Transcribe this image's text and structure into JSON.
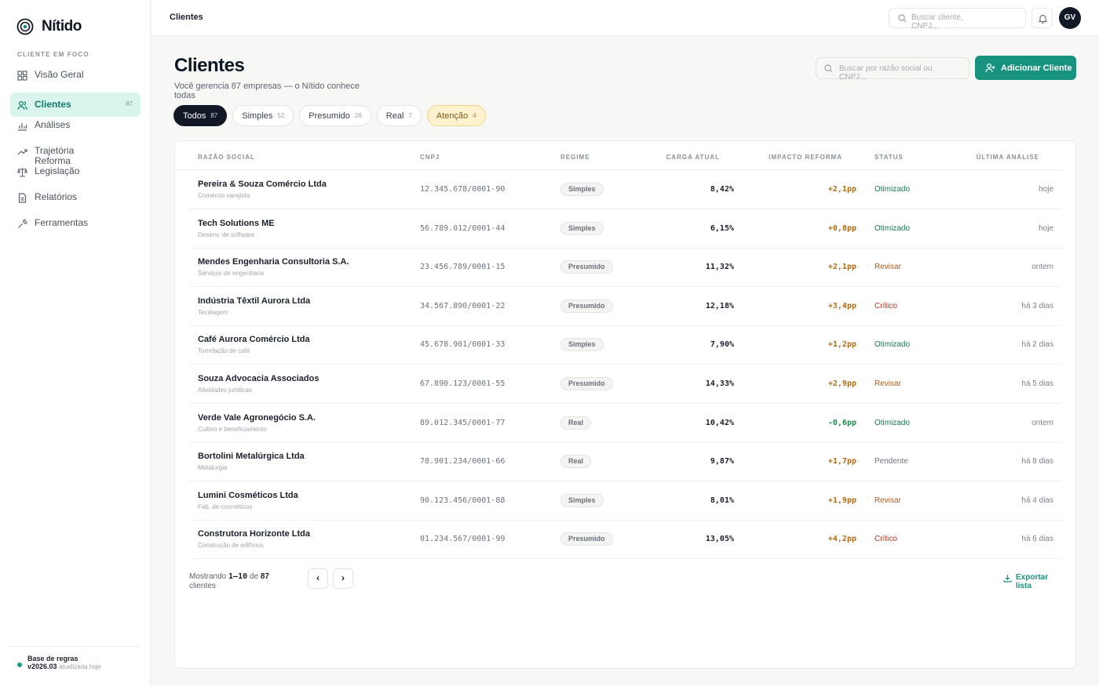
{
  "brand": {
    "name": "Nítido"
  },
  "sidebar": {
    "section_label": "CLIENTE EM FOCO",
    "items": [
      {
        "label": "Visão Geral",
        "icon": "grid-icon",
        "count": ""
      },
      {
        "label": "Clientes",
        "icon": "users-icon",
        "count": "87"
      },
      {
        "label": "Análises",
        "icon": "bar-chart-icon",
        "count": ""
      },
      {
        "label": "Trajetória Reforma",
        "icon": "trend-up-icon",
        "count": ""
      },
      {
        "label": "Legislação",
        "icon": "scale-icon",
        "count": ""
      },
      {
        "label": "Relatórios",
        "icon": "document-icon",
        "count": ""
      },
      {
        "label": "Ferramentas",
        "icon": "wrench-icon",
        "count": ""
      }
    ],
    "footer": {
      "title": "Base de regras v2026.03",
      "subtitle": "atualizada hoje"
    }
  },
  "topbar": {
    "breadcrumb": "Clientes",
    "search_placeholder": "Buscar cliente, CNPJ...",
    "avatar_initials": "GV"
  },
  "page": {
    "title": "Clientes",
    "subtitle": "Você gerencia 87 empresas — o Nítido conhece todas",
    "search_placeholder": "Buscar por razão social ou CNPJ...",
    "add_button": "Adicionar Cliente"
  },
  "filters": [
    {
      "label": "Todos",
      "count": "87"
    },
    {
      "label": "Simples",
      "count": "52"
    },
    {
      "label": "Presumido",
      "count": "28"
    },
    {
      "label": "Real",
      "count": "7"
    },
    {
      "label": "Atenção",
      "count": "4"
    }
  ],
  "table": {
    "columns": [
      "RAZÃO SOCIAL",
      "CNPJ",
      "REGIME",
      "CARGA ATUAL",
      "IMPACTO REFORMA",
      "STATUS",
      "ÚLTIMA ANÁLISE"
    ],
    "rows": [
      {
        "name": "Pereira & Souza Comércio Ltda",
        "desc": "Comércio varejista",
        "cnpj": "12.345.678/0001-90",
        "regime": "Simples",
        "carga": "8,42%",
        "impacto": "+2,1pp",
        "status": "Otimizado",
        "ultima": "hoje"
      },
      {
        "name": "Tech Solutions ME",
        "desc": "Desenv. de software",
        "cnpj": "56.789.012/0001-44",
        "regime": "Simples",
        "carga": "6,15%",
        "impacto": "+0,8pp",
        "status": "Otimizado",
        "ultima": "hoje"
      },
      {
        "name": "Mendes Engenharia Consultoria S.A.",
        "desc": "Serviços de engenharia",
        "cnpj": "23.456.789/0001-15",
        "regime": "Presumido",
        "carga": "11,32%",
        "impacto": "+2,1pp",
        "status": "Revisar",
        "ultima": "ontem"
      },
      {
        "name": "Indústria Têxtil Aurora Ltda",
        "desc": "Tecelagem",
        "cnpj": "34.567.890/0001-22",
        "regime": "Presumido",
        "carga": "12,18%",
        "impacto": "+3,4pp",
        "status": "Crítico",
        "ultima": "há 3 dias"
      },
      {
        "name": "Café Aurora Comércio Ltda",
        "desc": "Torrefação de café",
        "cnpj": "45.678.901/0001-33",
        "regime": "Simples",
        "carga": "7,90%",
        "impacto": "+1,2pp",
        "status": "Otimizado",
        "ultima": "há 2 dias"
      },
      {
        "name": "Souza Advocacia Associados",
        "desc": "Atividades jurídicas",
        "cnpj": "67.890.123/0001-55",
        "regime": "Presumido",
        "carga": "14,33%",
        "impacto": "+2,9pp",
        "status": "Revisar",
        "ultima": "há 5 dias"
      },
      {
        "name": "Verde Vale Agronegócio S.A.",
        "desc": "Cultivo e beneficiamento",
        "cnpj": "89.012.345/0001-77",
        "regime": "Real",
        "carga": "10,42%",
        "impacto": "-0,6pp",
        "status": "Otimizado",
        "ultima": "ontem"
      },
      {
        "name": "Bortolini Metalúrgica Ltda",
        "desc": "Metalurgia",
        "cnpj": "78.901.234/0001-66",
        "regime": "Real",
        "carga": "9,87%",
        "impacto": "+1,7pp",
        "status": "Pendente",
        "ultima": "há 8 dias"
      },
      {
        "name": "Lumini Cosméticos Ltda",
        "desc": "Fab. de cosméticos",
        "cnpj": "90.123.456/0001-88",
        "regime": "Simples",
        "carga": "8,01%",
        "impacto": "+1,9pp",
        "status": "Revisar",
        "ultima": "há 4 dias"
      },
      {
        "name": "Construtora Horizonte Ltda",
        "desc": "Construção de edifícios",
        "cnpj": "01.234.567/0001-99",
        "regime": "Presumido",
        "carga": "13,05%",
        "impacto": "+4,2pp",
        "status": "Crítico",
        "ultima": "há 6 dias"
      }
    ]
  },
  "pager": {
    "prefix": "Mostrando",
    "range": "1–10",
    "middle": "de",
    "total": "87",
    "suffix": "clientes",
    "prev": "‹",
    "next": "›"
  },
  "export_label": "Exportar lista",
  "colors": {
    "accent": "#17937f",
    "status_ok": "#1b7a4a",
    "status_warn": "#b05a16",
    "status_critical": "#c2311d",
    "status_pending": "#6c727d",
    "impact_positive": "#b06a12",
    "impact_negative": "#1b8a4e"
  }
}
